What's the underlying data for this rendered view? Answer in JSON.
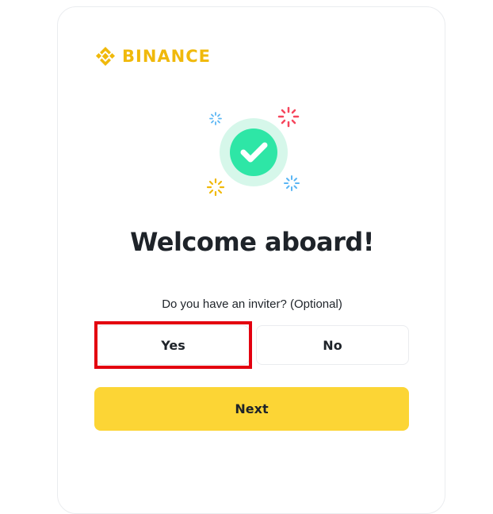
{
  "brand": {
    "name": "BINANCE",
    "color": "#f0b90b",
    "logo_icon": "binance-logo-icon"
  },
  "illustration": {
    "icon": "success-check-icon",
    "check_color": "#2ee6a6",
    "halo_color": "#d6f7ea",
    "sparkle_colors": [
      "#f6465d",
      "#f0b90b",
      "#5bb6f4"
    ]
  },
  "welcome": {
    "title": "Welcome aboard!"
  },
  "inviter": {
    "question": "Do you have an inviter? (Optional)",
    "yes_label": "Yes",
    "no_label": "No",
    "highlight_color": "#e3000f"
  },
  "actions": {
    "next_label": "Next",
    "next_color": "#fcd535"
  }
}
